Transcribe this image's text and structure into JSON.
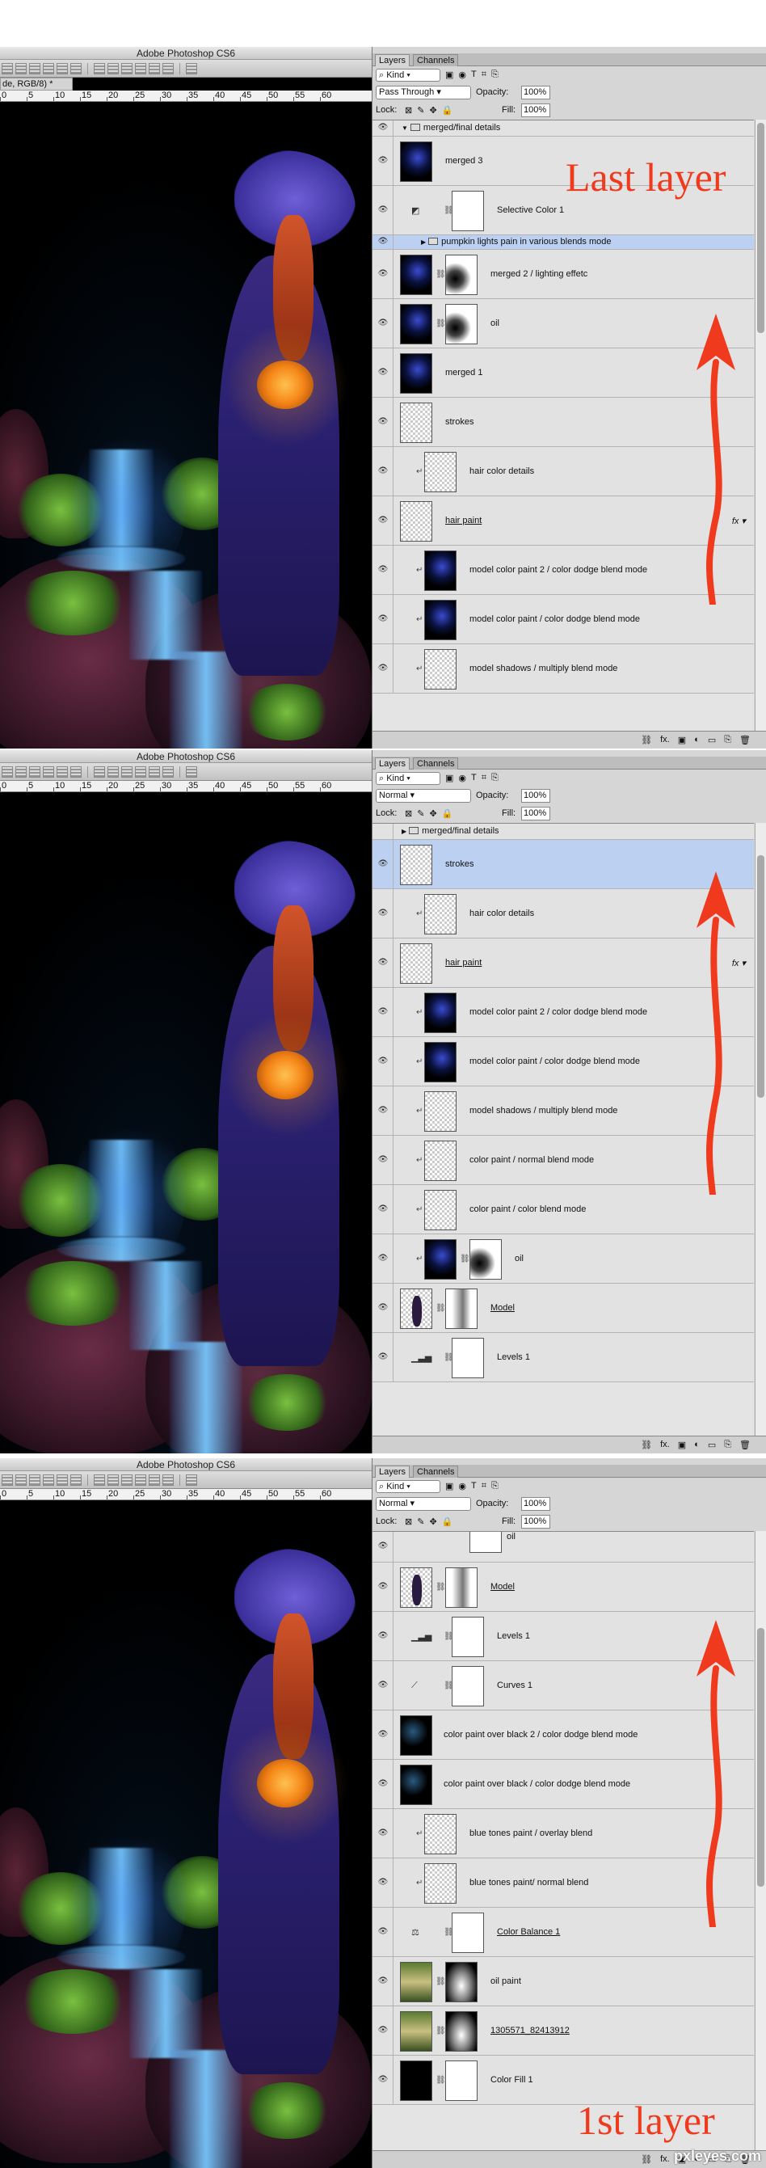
{
  "app": {
    "title": "Adobe Photoshop CS6",
    "doc_tab": "de, RGB/8) *",
    "ruler_ticks": [
      "0",
      "5",
      "10",
      "15",
      "20",
      "25",
      "30",
      "35",
      "40",
      "45",
      "50",
      "55",
      "60"
    ]
  },
  "panel": {
    "tabs": [
      "Layers",
      "Channels"
    ],
    "kind_label": "Kind",
    "opacity_label": "Opacity:",
    "fill_label": "Fill:",
    "lock_label": "Lock:",
    "filter_icons": [
      "▣",
      "◉",
      "T",
      "⌗",
      "⎘"
    ],
    "lock_icons": [
      "⊠",
      "✎",
      "✥",
      "🔒"
    ],
    "bottom_icons": [
      "⛓",
      "fx.",
      "▣",
      "◐",
      "▭",
      "⎘",
      "🗑"
    ]
  },
  "screens": [
    {
      "blend_mode": "Pass Through",
      "opacity": "100%",
      "fill": "100%",
      "annotation": "Last layer",
      "layers": [
        {
          "name": "merged/final details",
          "type": "group-open"
        },
        {
          "name": "merged 3",
          "type": "image"
        },
        {
          "name": "Selective Color 1",
          "type": "adjustment"
        },
        {
          "name": "pumpkin lights pain in various blends mode",
          "type": "group-closed",
          "selected": true
        },
        {
          "name": "merged 2 / lighting effetc",
          "type": "image-mask"
        },
        {
          "name": "oil",
          "type": "image-mask"
        },
        {
          "name": "merged 1",
          "type": "image"
        },
        {
          "name": "strokes",
          "type": "empty"
        },
        {
          "name": "hair color details",
          "type": "clip-empty"
        },
        {
          "name": "hair paint",
          "type": "empty-fx"
        },
        {
          "name": "model color paint 2 / color dodge blend mode",
          "type": "clip-image"
        },
        {
          "name": "model color paint / color dodge blend mode",
          "type": "clip-image"
        },
        {
          "name": "model shadows / multiply blend mode",
          "type": "clip-empty"
        }
      ]
    },
    {
      "blend_mode": "Normal",
      "opacity": "100%",
      "fill": "100%",
      "annotation": "",
      "layers": [
        {
          "name": "merged/final details",
          "type": "group-closed-top"
        },
        {
          "name": "strokes",
          "type": "empty",
          "selected": true
        },
        {
          "name": "hair color details",
          "type": "clip-empty"
        },
        {
          "name": "hair paint",
          "type": "empty-fx"
        },
        {
          "name": "model color paint 2 / color dodge blend mode",
          "type": "clip-image"
        },
        {
          "name": "model color paint / color dodge blend mode",
          "type": "clip-image"
        },
        {
          "name": "model shadows / multiply blend mode",
          "type": "clip-empty"
        },
        {
          "name": "color paint / normal blend mode",
          "type": "clip-empty"
        },
        {
          "name": "color paint / color blend mode",
          "type": "clip-empty"
        },
        {
          "name": "oil",
          "type": "clip-image-mask"
        },
        {
          "name": "Model",
          "type": "model-mask"
        },
        {
          "name": "Levels 1",
          "type": "levels"
        }
      ]
    },
    {
      "blend_mode": "Normal",
      "opacity": "100%",
      "fill": "100%",
      "annotation": "1st layer",
      "layers": [
        {
          "name": "oil",
          "type": "partial"
        },
        {
          "name": "Model",
          "type": "model-mask"
        },
        {
          "name": "Levels 1",
          "type": "levels"
        },
        {
          "name": "Curves 1",
          "type": "curves"
        },
        {
          "name": "color paint over black 2 / color dodge blend mode",
          "type": "black-image"
        },
        {
          "name": "color paint over black / color dodge blend mode",
          "type": "black-image"
        },
        {
          "name": "blue tones paint / overlay blend",
          "type": "clip-empty"
        },
        {
          "name": "blue tones paint/ normal blend",
          "type": "clip-empty"
        },
        {
          "name": "Color Balance 1",
          "type": "balance"
        },
        {
          "name": "oil paint",
          "type": "photo-mask"
        },
        {
          "name": "1305571_82413912",
          "type": "photo-mask"
        },
        {
          "name": "Color Fill 1",
          "type": "fill"
        }
      ]
    }
  ],
  "watermark": "pxleyes.com"
}
